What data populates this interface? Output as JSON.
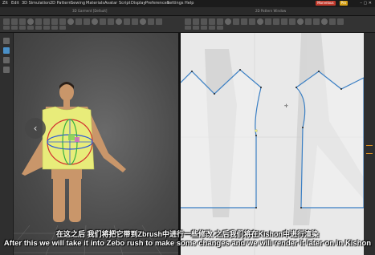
{
  "menu": {
    "items": [
      "Zlt",
      "Edit",
      "3D Simulation",
      "2D Pattern",
      "Sewing",
      "Materials",
      "Avatar",
      "Script",
      "Display",
      "Preferences",
      "Settings",
      "Help"
    ],
    "badge1": "Marvelous",
    "badge2": "Pro"
  },
  "tabs": {
    "left": "3D Garment [Default]",
    "right": "2D Pattern Window"
  },
  "subtitles": {
    "chinese": "在这之后 我们将把它带到Zbrush中进行一些修改 之后我们将在Kishon中进行渲染",
    "english": "After this we will take it into Zebo rush to make some changes and we will render it later on in Kishon"
  },
  "colors": {
    "pattern_outline": "#3a7fc4",
    "garment": "#e8ec7a",
    "gizmo_red": "#d23030",
    "gizmo_blue": "#2b58d8",
    "gizmo_green": "#35b040"
  }
}
